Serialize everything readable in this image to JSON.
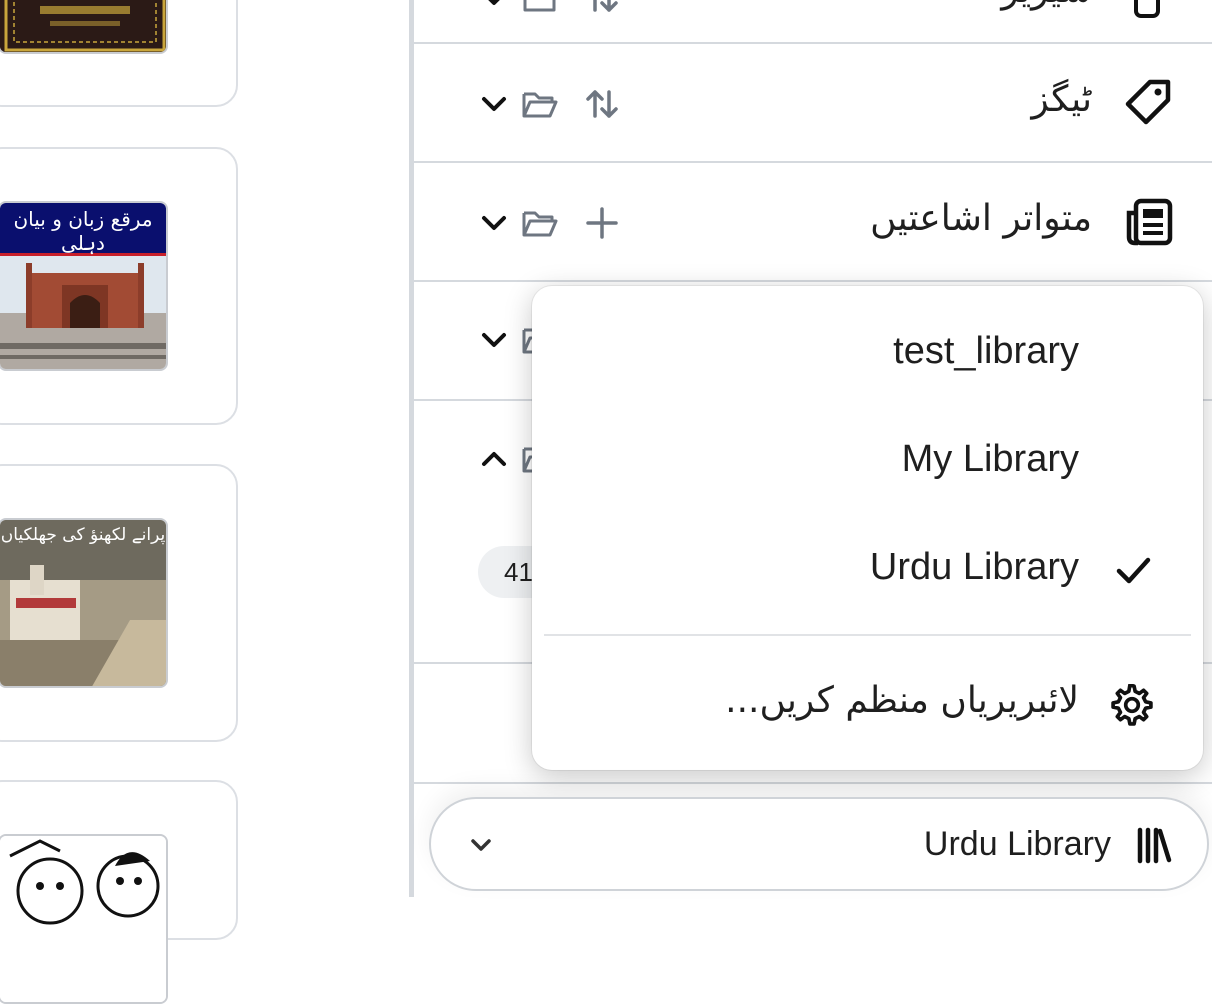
{
  "sidebar": {
    "sections": [
      {
        "label": "سیریز",
        "icon": "series-icon"
      },
      {
        "label": "ٹیگز",
        "icon": "tag-icon"
      },
      {
        "label": "متواتر اشاعتیں",
        "icon": "newspaper-icon"
      }
    ],
    "partial_count": "41"
  },
  "library_menu": {
    "items": [
      {
        "label": "test_library",
        "selected": false
      },
      {
        "label": "My Library",
        "selected": false
      },
      {
        "label": "Urdu Library",
        "selected": true
      }
    ],
    "manage_label": "لائبریریاں منظم کریں...",
    "manage_icon": "gear-icon"
  },
  "library_switcher": {
    "current": "Urdu Library",
    "icon": "library-icon"
  },
  "book_covers": [
    {
      "title_text": "",
      "palette": "dark-gold"
    },
    {
      "title_text": "مرقع زبان و بیان دہلی",
      "palette": "mosque"
    },
    {
      "title_text": "پرانے لکھنؤ کی جھلکیاں",
      "palette": "painting"
    },
    {
      "title_text": "",
      "palette": "cartoon"
    }
  ],
  "colors": {
    "divider": "#d5d9de",
    "icon_gray": "#6e7681",
    "text": "#1f1f1f"
  }
}
